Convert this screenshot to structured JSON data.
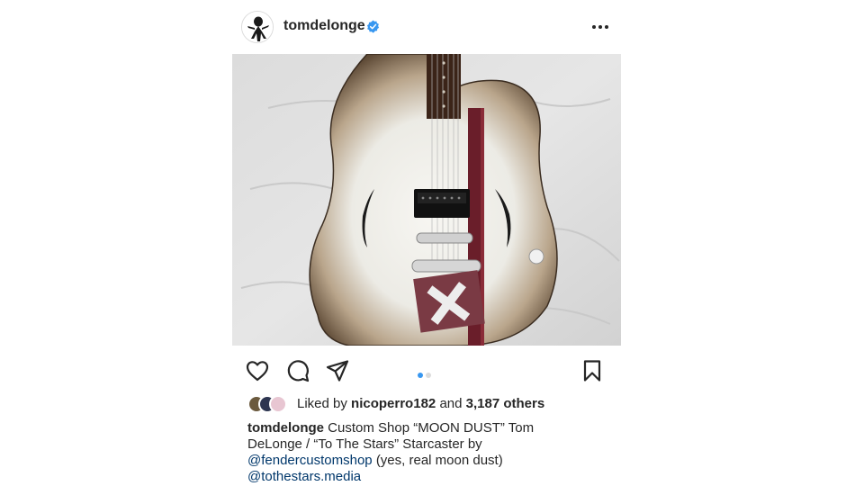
{
  "post": {
    "username": "tomdelonge",
    "verified": true,
    "more_icon": "more-horizontal-icon"
  },
  "media": {
    "carousel_index": 1,
    "carousel_total": 2,
    "subject": "guitar-photo"
  },
  "actions": {
    "like_icon": "heart-icon",
    "comment_icon": "comment-icon",
    "share_icon": "send-icon",
    "save_icon": "bookmark-icon"
  },
  "likes": {
    "prefix": "Liked by",
    "liker": "nicoperro182",
    "connector": "and",
    "others": "3,187 others"
  },
  "caption": {
    "username": "tomdelonge",
    "text_1": "Custom Shop “MOON DUST” Tom DeLonge / “To The Stars” Starcaster by",
    "mention_1": "@fendercustomshop",
    "text_2": "(yes, real moon dust)",
    "mention_2": "@tothestars.media"
  },
  "colors": {
    "verified_blue": "#3897f0",
    "mention_blue": "#00376b",
    "text": "#262626"
  }
}
